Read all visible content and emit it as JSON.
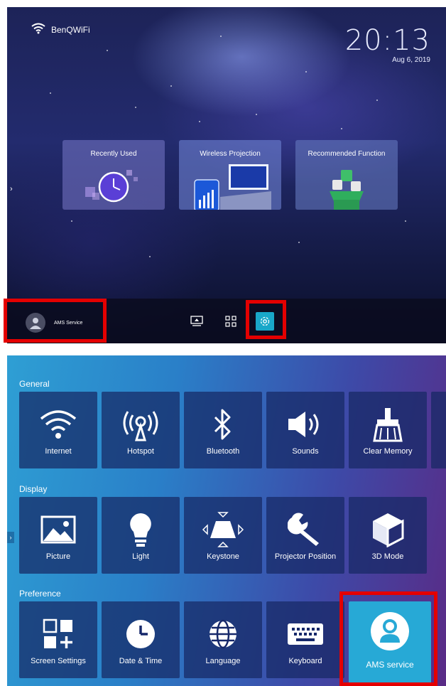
{
  "home": {
    "network": {
      "icon": "wifi-icon",
      "name": "BenQWiFi"
    },
    "clock": {
      "time": "20:13",
      "date": "Aug 6, 2019"
    },
    "cards": [
      {
        "label": "Recently Used",
        "icon": "clock-icon"
      },
      {
        "label": "Wireless Projection",
        "icon": "phone-screen-icon"
      },
      {
        "label": "Recommended Function",
        "icon": "apps-box-icon"
      }
    ],
    "profile": {
      "label": "AMS Service",
      "icon": "user-avatar-icon"
    },
    "dock": [
      "screen-cast-icon",
      "apps-grid-icon",
      "settings-gear-icon"
    ]
  },
  "settings": {
    "sections": {
      "general": "General",
      "display": "Display",
      "preference": "Preference"
    },
    "general_items": [
      "Internet",
      "Hotspot",
      "Bluetooth",
      "Sounds",
      "Clear Memory"
    ],
    "display_items": [
      "Picture",
      "Light",
      "Keystone",
      "Projector Position",
      "3D Mode"
    ],
    "preference_items": [
      "Screen Settings",
      "Date & Time",
      "Language",
      "Keyboard",
      "AMS service"
    ]
  },
  "colors": {
    "highlight": "#e40000",
    "selected_tile": "#27a9d6",
    "settings_button": "#19a7c9"
  }
}
